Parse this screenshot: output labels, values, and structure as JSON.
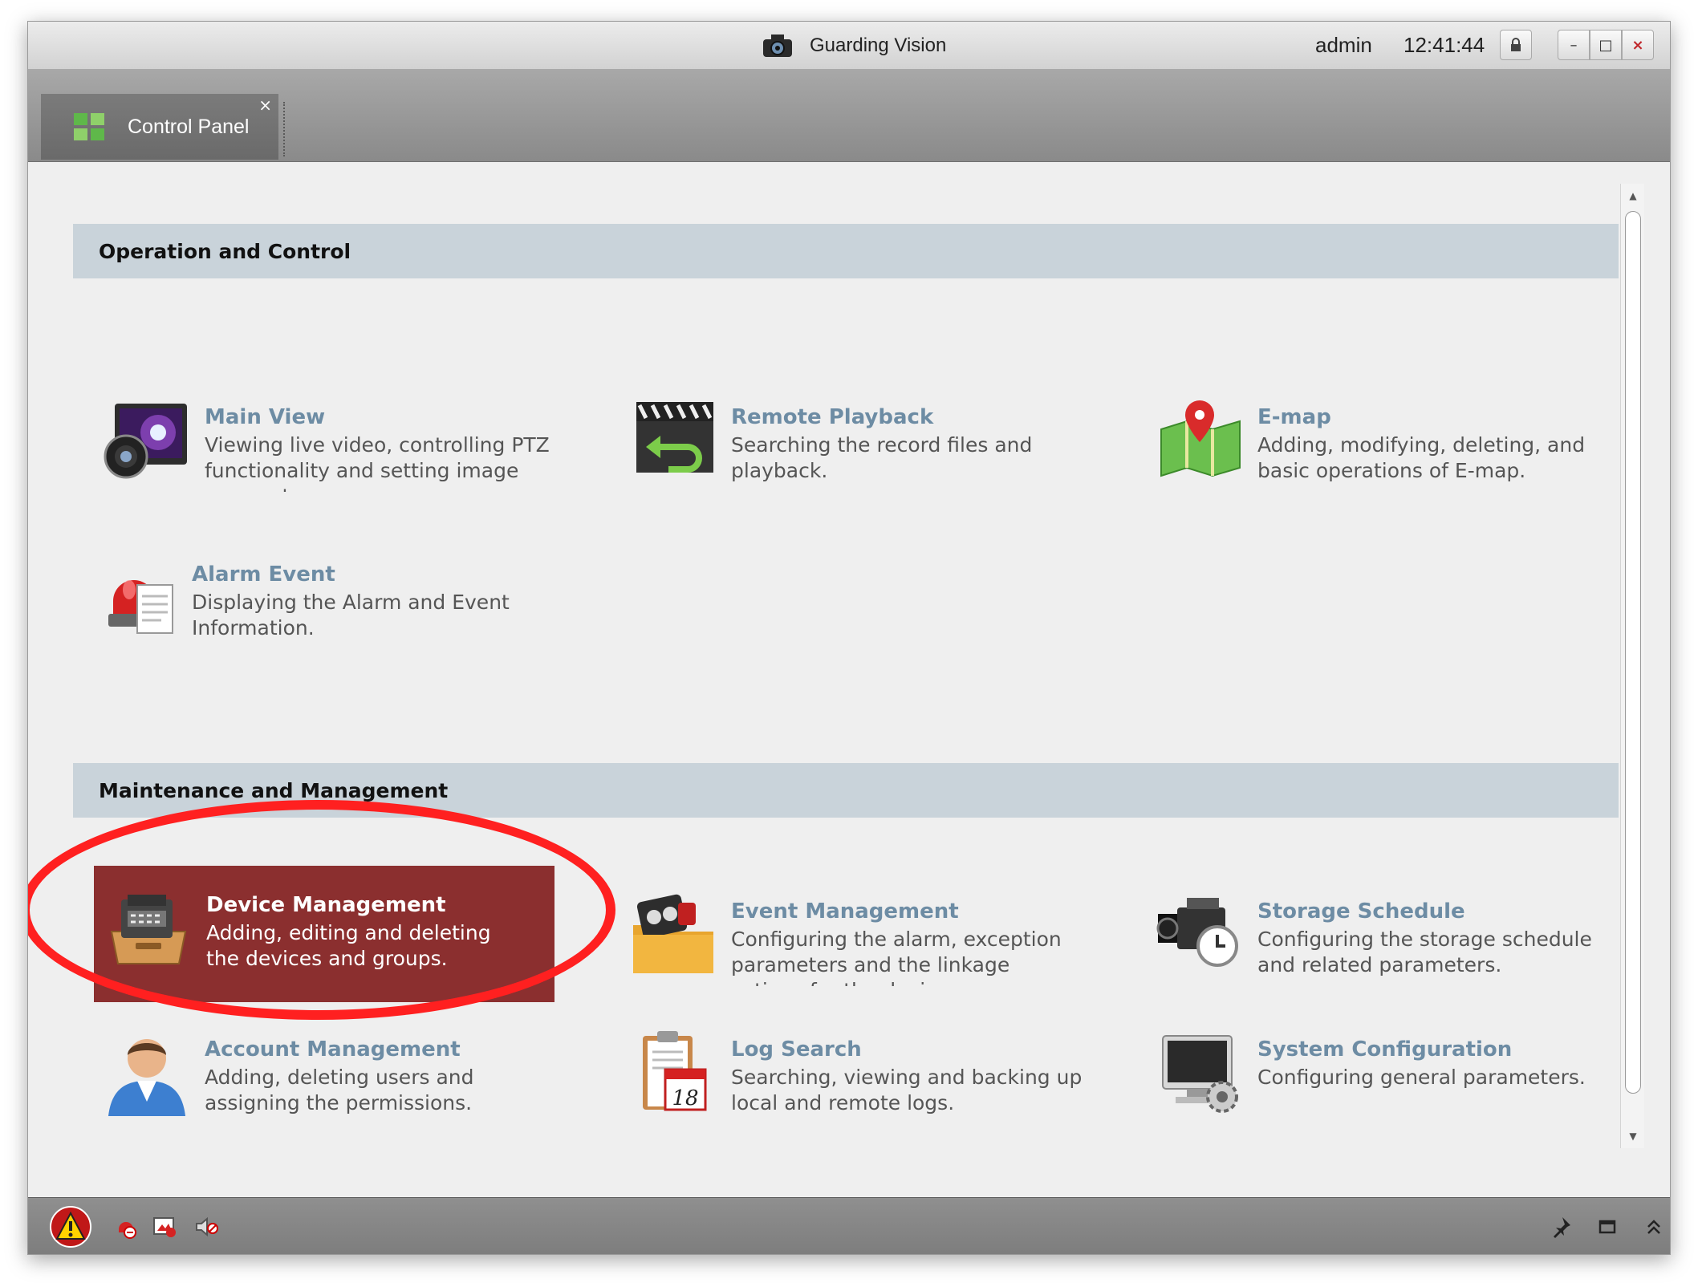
{
  "window": {
    "title": "Guarding Vision",
    "user": "admin",
    "time": "12:41:44",
    "buttons": {
      "lock": "lock-icon",
      "minimize": "–",
      "maximize": "□",
      "close": "×"
    }
  },
  "tab": {
    "label": "Control Panel",
    "close": "×"
  },
  "sections": [
    {
      "title": "Operation and Control",
      "items": [
        {
          "name": "Main View",
          "desc": "Viewing live video, controlling PTZ functionality and setting image parameters.",
          "icon": "main-view-icon"
        },
        {
          "name": "Remote Playback",
          "desc": "Searching the record files and playback.",
          "icon": "remote-playback-icon"
        },
        {
          "name": "E-map",
          "desc": "Adding, modifying, deleting, and basic operations of E-map.",
          "icon": "e-map-icon"
        },
        {
          "name": "Alarm Event",
          "desc": "Displaying the Alarm and Event Information.",
          "icon": "alarm-event-icon"
        }
      ]
    },
    {
      "title": "Maintenance and Management",
      "items": [
        {
          "name": "Device Management",
          "desc": "Adding, editing and deleting the devices and groups.",
          "icon": "device-management-icon",
          "selected": true
        },
        {
          "name": "Event Management",
          "desc": "Configuring the alarm, exception parameters and the linkage actions for the devices.",
          "icon": "event-management-icon"
        },
        {
          "name": "Storage Schedule",
          "desc": "Configuring the storage schedule and related parameters.",
          "icon": "storage-schedule-icon"
        },
        {
          "name": "Account Management",
          "desc": "Adding, deleting users and assigning the permissions.",
          "icon": "account-management-icon"
        },
        {
          "name": "Log Search",
          "desc": "Searching, viewing and backing up local and remote logs.",
          "icon": "log-search-icon",
          "calendar_day": "18"
        },
        {
          "name": "System Configuration",
          "desc": "Configuring general parameters.",
          "icon": "system-configuration-icon"
        }
      ]
    }
  ],
  "colors": {
    "link": "#6d8ca4",
    "selected_bg": "#8b2f2f",
    "section_bg": "#c9d3da",
    "annotation": "#ff2020"
  }
}
